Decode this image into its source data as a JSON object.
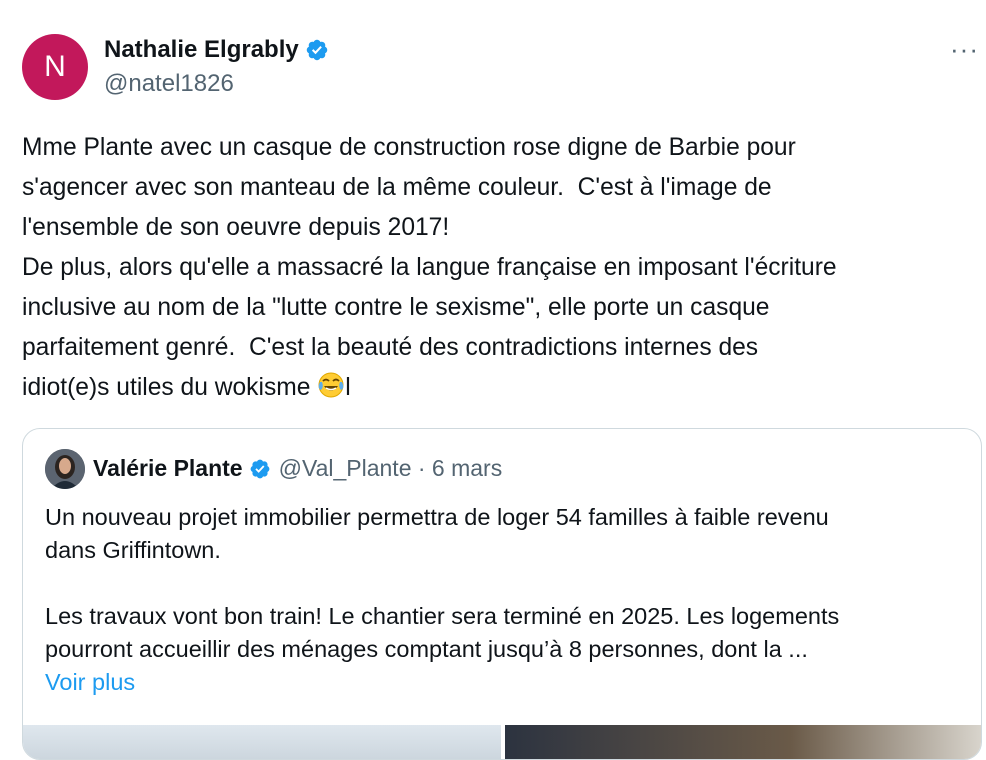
{
  "author": {
    "avatar_initial": "N",
    "avatar_color": "#c2185b",
    "name": "Nathalie Elgrably",
    "verified_icon": "verified-badge-icon",
    "handle": "@natel1826"
  },
  "more_label": "···",
  "tweet": {
    "lines": [
      "Mme Plante avec un casque de construction rose digne de Barbie pour",
      "s'agencer avec son manteau de la même couleur.  C'est à l'image de",
      "l'ensemble de son oeuvre depuis 2017!",
      "De plus, alors qu'elle a massacré la langue française en imposant l'écriture",
      "inclusive au nom de la \"lutte contre le sexisme\", elle porte un casque",
      "parfaitement genré.  C'est la beauté des contradictions internes des",
      "idiot(e)s utiles du wokisme "
    ],
    "emoji_icon": "face-with-tears-of-joy-icon",
    "trailing_text": "l"
  },
  "quote": {
    "name": "Valérie Plante",
    "meta": "@Val_Plante · 6 mars",
    "lines": [
      "Un nouveau projet immobilier permettra de loger 54 familles à faible revenu",
      "dans Griffintown.",
      "",
      "Les travaux vont bon train! Le chantier sera terminé en 2025. Les logements",
      "pourront accueillir des ménages comptant jusqu’à 8 personnes, dont la ..."
    ],
    "voir_plus": "Voir plus"
  },
  "colors": {
    "accent": "#1d9bf0",
    "secondary_text": "#536471",
    "border": "#cfd9de"
  }
}
